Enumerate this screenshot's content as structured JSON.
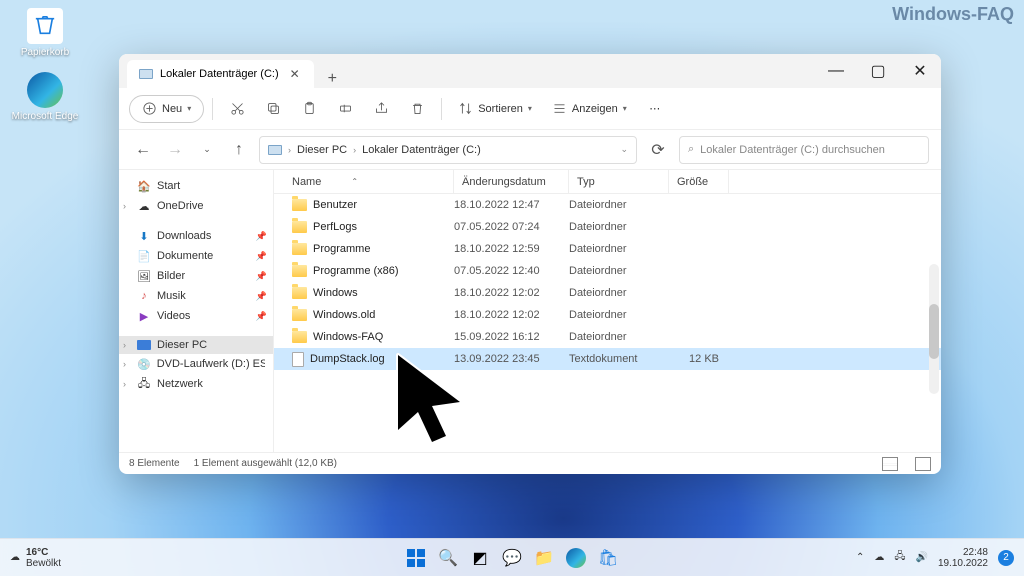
{
  "watermark": "Windows-FAQ",
  "desktop": {
    "recycle": "Papierkorb",
    "edge": "Microsoft Edge"
  },
  "window": {
    "tab_title": "Lokaler Datenträger (C:)",
    "toolbar": {
      "new": "Neu",
      "sort": "Sortieren",
      "view": "Anzeigen"
    },
    "breadcrumb": [
      "Dieser PC",
      "Lokaler Datenträger (C:)"
    ],
    "search_placeholder": "Lokaler Datenträger (C:) durchsuchen",
    "columns": {
      "name": "Name",
      "modified": "Änderungsdatum",
      "type": "Typ",
      "size": "Größe"
    },
    "sidebar": {
      "start": "Start",
      "onedrive": "OneDrive",
      "downloads": "Downloads",
      "documents": "Dokumente",
      "pictures": "Bilder",
      "music": "Musik",
      "videos": "Videos",
      "thispc": "Dieser PC",
      "dvd": "DVD-Laufwerk (D:) ESD-I",
      "network": "Netzwerk"
    },
    "files": [
      {
        "name": "Benutzer",
        "date": "18.10.2022 12:47",
        "type": "Dateiordner",
        "size": "",
        "kind": "folder"
      },
      {
        "name": "PerfLogs",
        "date": "07.05.2022 07:24",
        "type": "Dateiordner",
        "size": "",
        "kind": "folder"
      },
      {
        "name": "Programme",
        "date": "18.10.2022 12:59",
        "type": "Dateiordner",
        "size": "",
        "kind": "folder"
      },
      {
        "name": "Programme (x86)",
        "date": "07.05.2022 12:40",
        "type": "Dateiordner",
        "size": "",
        "kind": "folder"
      },
      {
        "name": "Windows",
        "date": "18.10.2022 12:02",
        "type": "Dateiordner",
        "size": "",
        "kind": "folder"
      },
      {
        "name": "Windows.old",
        "date": "18.10.2022 12:02",
        "type": "Dateiordner",
        "size": "",
        "kind": "folder"
      },
      {
        "name": "Windows-FAQ",
        "date": "15.09.2022 16:12",
        "type": "Dateiordner",
        "size": "",
        "kind": "folder"
      },
      {
        "name": "DumpStack.log",
        "date": "13.09.2022 23:45",
        "type": "Textdokument",
        "size": "12 KB",
        "kind": "file",
        "selected": true
      }
    ],
    "status": {
      "count": "8 Elemente",
      "selection": "1 Element ausgewählt (12,0 KB)"
    }
  },
  "taskbar": {
    "temp": "16°C",
    "weather": "Bewölkt",
    "time": "22:48",
    "date": "19.10.2022",
    "notif": "2"
  }
}
